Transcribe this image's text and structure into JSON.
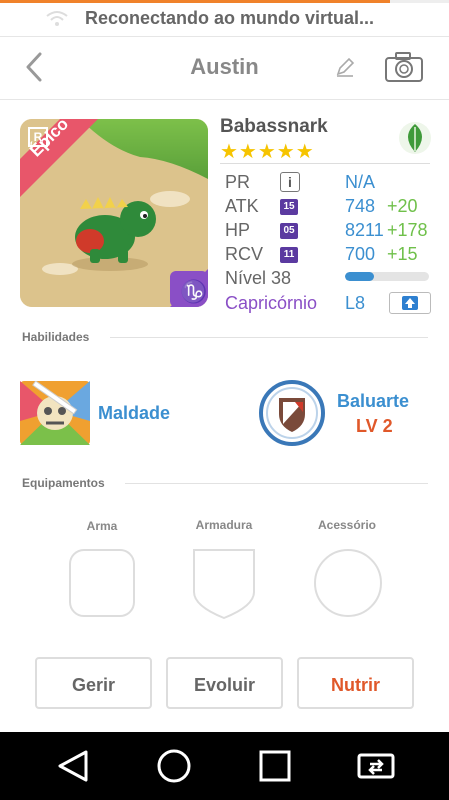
{
  "status": {
    "text": "Reconectando ao mundo virtual...",
    "progress": 0.87
  },
  "header": {
    "title": "Austin"
  },
  "monster": {
    "rarity": "Épico",
    "rarity_badge": "R",
    "name": "Babassnark",
    "stars": "★★★★★",
    "element": "leaf-icon"
  },
  "stats": {
    "pr": {
      "label": "PR",
      "value": "N/A"
    },
    "atk": {
      "label": "ATK",
      "badge": "15",
      "value": "748",
      "plus": "+20"
    },
    "hp": {
      "label": "HP",
      "badge": "05",
      "value": "8211",
      "plus": "+178"
    },
    "rcv": {
      "label": "RCV",
      "badge": "11",
      "value": "700",
      "plus": "+15"
    },
    "level": {
      "label": "Nível 38",
      "progress": 0.35
    },
    "sign": {
      "label": "Capricórnio",
      "value": "L8"
    }
  },
  "skills": {
    "title": "Habilidades",
    "active": {
      "name": "Maldade"
    },
    "passive": {
      "name": "Baluarte",
      "level": "LV 2"
    }
  },
  "equipment": {
    "title": "Equipamentos",
    "slots": [
      "Arma",
      "Armadura",
      "Acessório"
    ]
  },
  "actions": {
    "manage": "Gerir",
    "evolve": "Evoluir",
    "feed": "Nutrir"
  },
  "colors": {
    "accent": "#3b8fd0",
    "plus": "#6fc04a",
    "highlight": "#e0582a",
    "rarity": "#e8566a",
    "badge": "#5b3aa0",
    "sign": "#8a4fc6"
  }
}
